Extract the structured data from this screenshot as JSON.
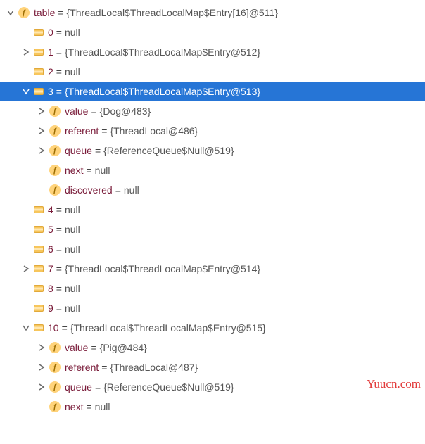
{
  "tree": [
    {
      "depth": 0,
      "toggle": "down",
      "icon": "field",
      "name": "table",
      "value": "{ThreadLocal$ThreadLocalMap$Entry[16]@511}",
      "selected": false
    },
    {
      "depth": 1,
      "toggle": "none",
      "icon": "slot",
      "name": "0",
      "value": "null",
      "selected": false
    },
    {
      "depth": 1,
      "toggle": "right",
      "icon": "slot",
      "name": "1",
      "value": "{ThreadLocal$ThreadLocalMap$Entry@512}",
      "selected": false
    },
    {
      "depth": 1,
      "toggle": "none",
      "icon": "slot",
      "name": "2",
      "value": "null",
      "selected": false
    },
    {
      "depth": 1,
      "toggle": "down",
      "icon": "slot",
      "name": "3",
      "value": "{ThreadLocal$ThreadLocalMap$Entry@513}",
      "selected": true
    },
    {
      "depth": 2,
      "toggle": "right",
      "icon": "field",
      "name": "value",
      "value": "{Dog@483}",
      "selected": false
    },
    {
      "depth": 2,
      "toggle": "right",
      "icon": "field",
      "name": "referent",
      "value": "{ThreadLocal@486}",
      "selected": false
    },
    {
      "depth": 2,
      "toggle": "right",
      "icon": "field",
      "name": "queue",
      "value": "{ReferenceQueue$Null@519}",
      "selected": false
    },
    {
      "depth": 2,
      "toggle": "none",
      "icon": "field",
      "name": "next",
      "value": "null",
      "selected": false
    },
    {
      "depth": 2,
      "toggle": "none",
      "icon": "field",
      "name": "discovered",
      "value": "null",
      "selected": false
    },
    {
      "depth": 1,
      "toggle": "none",
      "icon": "slot",
      "name": "4",
      "value": "null",
      "selected": false
    },
    {
      "depth": 1,
      "toggle": "none",
      "icon": "slot",
      "name": "5",
      "value": "null",
      "selected": false
    },
    {
      "depth": 1,
      "toggle": "none",
      "icon": "slot",
      "name": "6",
      "value": "null",
      "selected": false
    },
    {
      "depth": 1,
      "toggle": "right",
      "icon": "slot",
      "name": "7",
      "value": "{ThreadLocal$ThreadLocalMap$Entry@514}",
      "selected": false
    },
    {
      "depth": 1,
      "toggle": "none",
      "icon": "slot",
      "name": "8",
      "value": "null",
      "selected": false
    },
    {
      "depth": 1,
      "toggle": "none",
      "icon": "slot",
      "name": "9",
      "value": "null",
      "selected": false
    },
    {
      "depth": 1,
      "toggle": "down",
      "icon": "slot",
      "name": "10",
      "value": "{ThreadLocal$ThreadLocalMap$Entry@515}",
      "selected": false
    },
    {
      "depth": 2,
      "toggle": "right",
      "icon": "field",
      "name": "value",
      "value": "{Pig@484}",
      "selected": false
    },
    {
      "depth": 2,
      "toggle": "right",
      "icon": "field",
      "name": "referent",
      "value": "{ThreadLocal@487}",
      "selected": false
    },
    {
      "depth": 2,
      "toggle": "right",
      "icon": "field",
      "name": "queue",
      "value": "{ReferenceQueue$Null@519}",
      "selected": false
    },
    {
      "depth": 2,
      "toggle": "none",
      "icon": "field",
      "name": "next",
      "value": "null",
      "selected": false
    }
  ],
  "indent_unit": 22,
  "indent_base": 4,
  "watermark": "Yuucn.com"
}
